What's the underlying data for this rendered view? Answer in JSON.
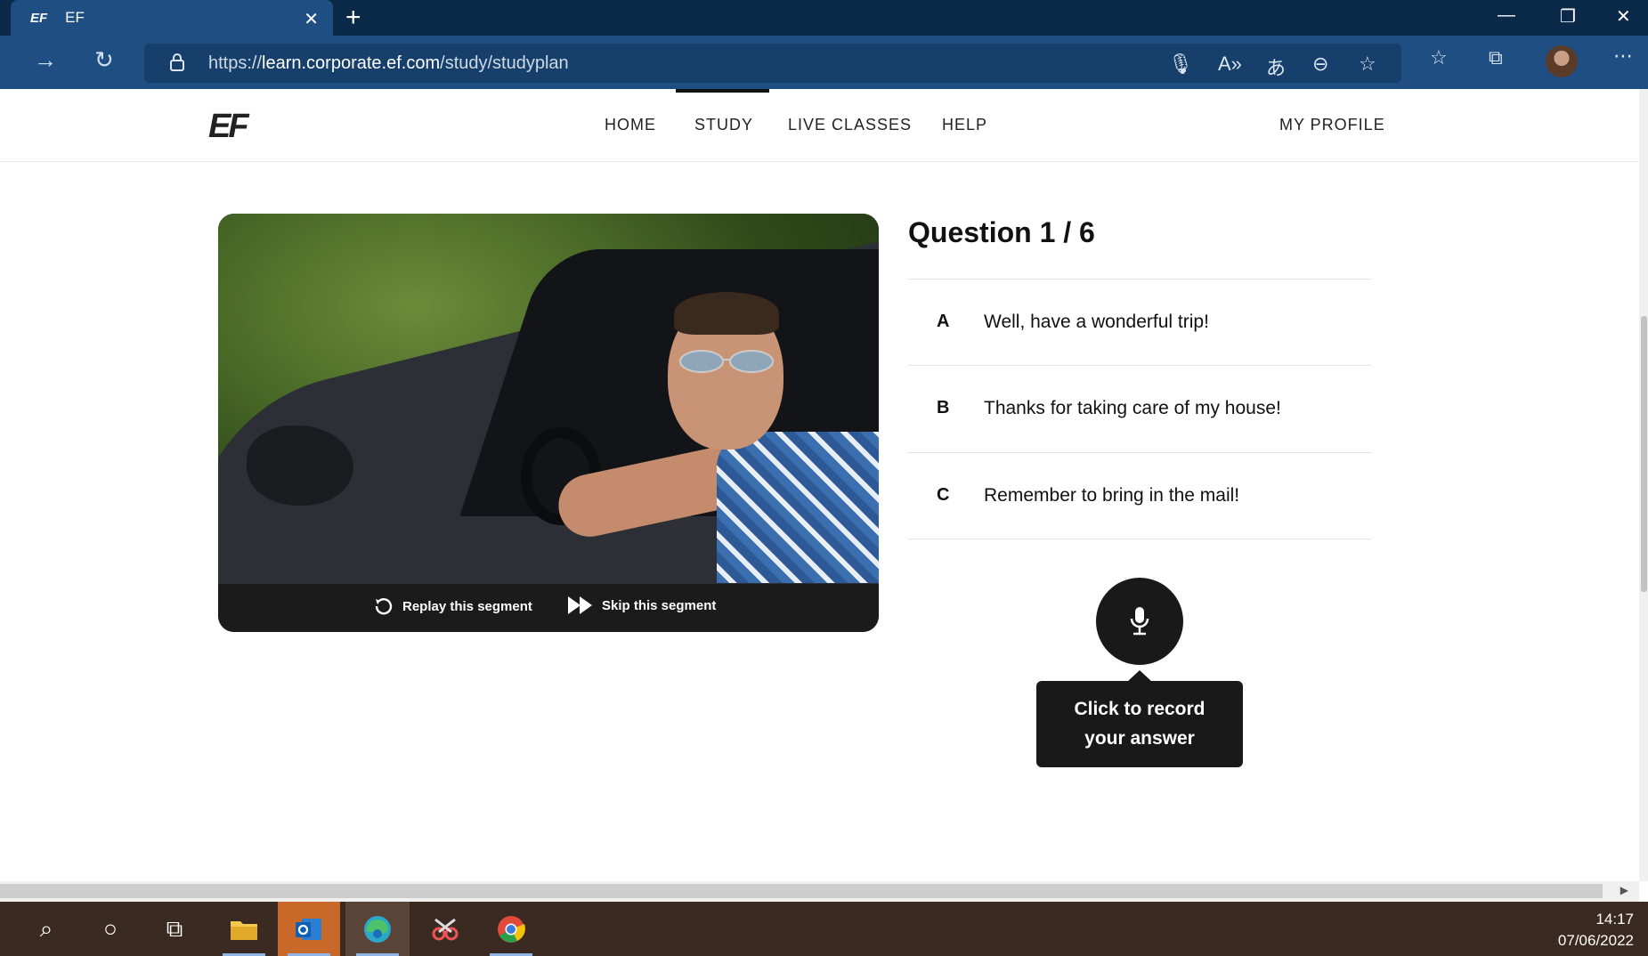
{
  "browser": {
    "tab_title": "EF",
    "tab_favicon": "EF",
    "url_prefix": "https://",
    "url_domain": "learn.corporate.ef.com",
    "url_path": "/study/studyplan"
  },
  "site": {
    "logo": "EF",
    "nav": [
      "HOME",
      "STUDY",
      "LIVE CLASSES",
      "HELP"
    ],
    "active_nav": "STUDY",
    "profile": "MY PROFILE"
  },
  "video": {
    "replay_label": "Replay this segment",
    "skip_label": "Skip this segment"
  },
  "question": {
    "title": "Question 1 / 6",
    "options": [
      {
        "letter": "A",
        "text": "Well, have a wonderful trip!"
      },
      {
        "letter": "B",
        "text": "Thanks for taking care of my house!"
      },
      {
        "letter": "C",
        "text": "Remember to bring in the mail!"
      }
    ],
    "record_tooltip_line1": "Click to record",
    "record_tooltip_line2": "your answer"
  },
  "taskbar": {
    "time": "14:17",
    "date": "07/06/2022"
  },
  "colors": {
    "chrome_dark": "#0b2a4a",
    "chrome_toolbar": "#1f4f82",
    "dark_button": "#191919",
    "taskbar": "#3a2a22"
  }
}
